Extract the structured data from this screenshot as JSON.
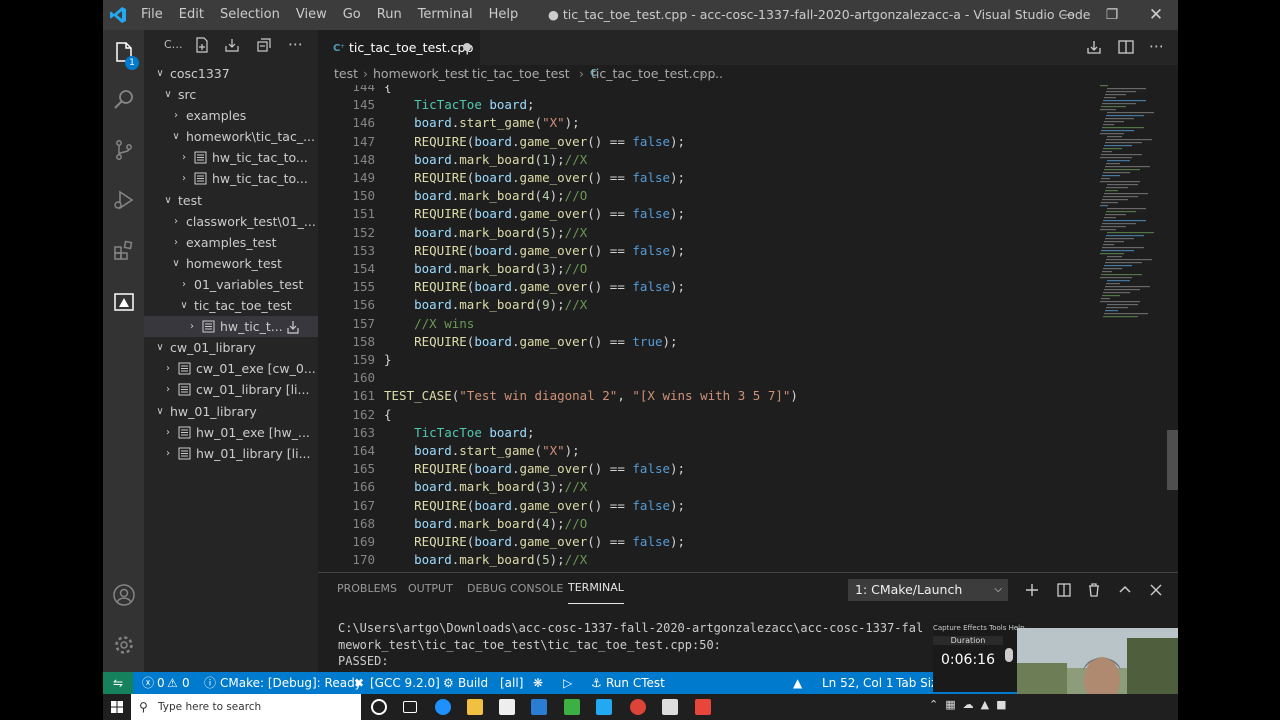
{
  "window": {
    "title": "● tic_tac_toe_test.cpp - acc-cosc-1337-fall-2020-artgonzalezacc-a - Visual Studio Code",
    "menu": [
      "File",
      "Edit",
      "Selection",
      "View",
      "Go",
      "Run",
      "Terminal",
      "Help"
    ]
  },
  "activity": {
    "extensions_badge": "1"
  },
  "sidebar": {
    "header": "C…",
    "tree": [
      {
        "label": "cosc1337",
        "indent": 0,
        "chev": "v"
      },
      {
        "label": "src",
        "indent": 1,
        "chev": "v"
      },
      {
        "label": "examples",
        "indent": 2,
        "chev": ">"
      },
      {
        "label": "homework\\tic_tac_...",
        "indent": 2,
        "chev": "v"
      },
      {
        "label": "hw_tic_tac_to...",
        "indent": 3,
        "chev": ">",
        "icon": true
      },
      {
        "label": "hw_tic_tac_to...",
        "indent": 3,
        "chev": ">",
        "icon": true
      },
      {
        "label": "test",
        "indent": 1,
        "chev": "v"
      },
      {
        "label": "classwork_test\\01_...",
        "indent": 2,
        "chev": ">"
      },
      {
        "label": "examples_test",
        "indent": 2,
        "chev": ">"
      },
      {
        "label": "homework_test",
        "indent": 2,
        "chev": "v"
      },
      {
        "label": "01_variables_test",
        "indent": 3,
        "chev": ">"
      },
      {
        "label": "tic_tac_toe_test",
        "indent": 3,
        "chev": "v"
      },
      {
        "label": "hw_tic_t...",
        "indent": 4,
        "chev": ">",
        "icon": true,
        "selected": true
      },
      {
        "label": "cw_01_library",
        "indent": 0,
        "chev": "v"
      },
      {
        "label": "cw_01_exe [cw_0...",
        "indent": 1,
        "chev": ">",
        "icon": true
      },
      {
        "label": "cw_01_library [li...",
        "indent": 1,
        "chev": ">",
        "icon": true
      },
      {
        "label": "hw_01_library",
        "indent": 0,
        "chev": "v"
      },
      {
        "label": "hw_01_exe [hw_...",
        "indent": 1,
        "chev": ">",
        "icon": true
      },
      {
        "label": "hw_01_library [li...",
        "indent": 1,
        "chev": ">",
        "icon": true
      }
    ]
  },
  "editor": {
    "tab": "tic_tac_toe_test.cpp",
    "breadcrumb": [
      "test",
      "homework_test",
      "tic_tac_toe_test",
      "tic_tac_toe_test.cpp",
      "..."
    ],
    "lines": [
      {
        "n": "144",
        "code": "{"
      },
      {
        "n": "145",
        "code": "    TicTacToe board;"
      },
      {
        "n": "146",
        "code": "    board.start_game(\"X\");"
      },
      {
        "n": "147",
        "code": "    REQUIRE(board.game_over() == false);"
      },
      {
        "n": "148",
        "code": "    board.mark_board(1);//X"
      },
      {
        "n": "149",
        "code": "    REQUIRE(board.game_over() == false);"
      },
      {
        "n": "150",
        "code": "    board.mark_board(4);//O"
      },
      {
        "n": "151",
        "code": "    REQUIRE(board.game_over() == false);"
      },
      {
        "n": "152",
        "code": "    board.mark_board(5);//X"
      },
      {
        "n": "153",
        "code": "    REQUIRE(board.game_over() == false);"
      },
      {
        "n": "154",
        "code": "    board.mark_board(3);//O"
      },
      {
        "n": "155",
        "code": "    REQUIRE(board.game_over() == false);"
      },
      {
        "n": "156",
        "code": "    board.mark_board(9);//X"
      },
      {
        "n": "157",
        "code": "    //X wins"
      },
      {
        "n": "158",
        "code": "    REQUIRE(board.game_over() == true);"
      },
      {
        "n": "159",
        "code": "}"
      },
      {
        "n": "160",
        "code": ""
      },
      {
        "n": "161",
        "code": "TEST_CASE(\"Test win diagonal 2\", \"[X wins with 3 5 7]\")"
      },
      {
        "n": "162",
        "code": "{"
      },
      {
        "n": "163",
        "code": "    TicTacToe board;"
      },
      {
        "n": "164",
        "code": "    board.start_game(\"X\");"
      },
      {
        "n": "165",
        "code": "    REQUIRE(board.game_over() == false);"
      },
      {
        "n": "166",
        "code": "    board.mark_board(3);//X"
      },
      {
        "n": "167",
        "code": "    REQUIRE(board.game_over() == false);"
      },
      {
        "n": "168",
        "code": "    board.mark_board(4);//O"
      },
      {
        "n": "169",
        "code": "    REQUIRE(board.game_over() == false);"
      },
      {
        "n": "170",
        "code": "    board.mark_board(5);//X"
      }
    ]
  },
  "panel": {
    "tabs": [
      "PROBLEMS",
      "OUTPUT",
      "DEBUG CONSOLE",
      "TERMINAL"
    ],
    "active_tab": "TERMINAL",
    "terminal_select": "1: CMake/Launch",
    "terminal_lines": [
      "C:\\Users\\artgo\\Downloads\\acc-cosc-1337-fall-2020-artgonzalezacc\\acc-cosc-1337-fal",
      "mework_test\\tic_tac_toe_test\\tic_tac_toe_test.cpp:50:",
      "PASSED:"
    ]
  },
  "status": {
    "errors": "0",
    "warnings": "0",
    "cmake": "CMake: [Debug]: Ready",
    "compiler": "[GCC 9.2.0]",
    "build": "Build",
    "target": "[all]",
    "ctest": "Run CTest",
    "position": "Ln 52, Col 1",
    "tab_size": "Tab Siz"
  },
  "recorder": {
    "menu": [
      "Capture",
      "Effects",
      "Tools",
      "Help"
    ],
    "duration_label": "Duration",
    "duration": "0:06:16"
  },
  "taskbar": {
    "search_placeholder": "Type here to search"
  },
  "colors": {
    "accent": "#007acc",
    "activity": "#333333",
    "sidebar": "#252526",
    "editor": "#1e1e1e"
  }
}
